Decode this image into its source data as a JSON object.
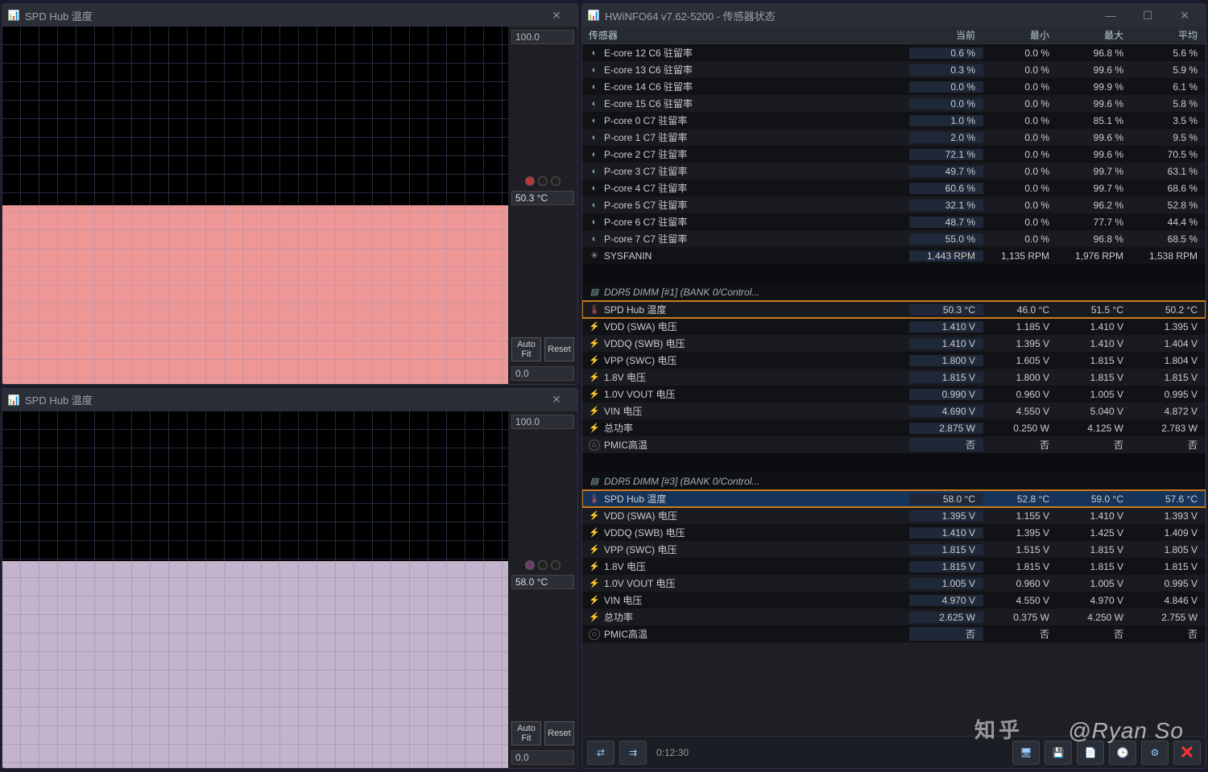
{
  "graph1": {
    "title": "SPD Hub 温度",
    "scaleTop": "100.0",
    "value": "50.3 °C",
    "autofit": "Auto Fit",
    "reset": "Reset",
    "scaleBottom": "0.0"
  },
  "graph2": {
    "title": "SPD Hub 温度",
    "scaleTop": "100.0",
    "value": "58.0 °C",
    "autofit": "Auto Fit",
    "reset": "Reset",
    "scaleBottom": "0.0"
  },
  "hw": {
    "title": "HWiNFO64 v7.62-5200 - 传感器状态",
    "cols": {
      "name": "传感器",
      "cur": "当前",
      "min": "最小",
      "max": "最大",
      "avg": "平均"
    },
    "rows": [
      {
        "t": "d",
        "icon": "chip",
        "n": "E-core 12 C6 驻留率",
        "c": "0.6 %",
        "mn": "0.0 %",
        "mx": "96.8 %",
        "a": "5.6 %"
      },
      {
        "t": "d",
        "icon": "chip",
        "n": "E-core 13 C6 驻留率",
        "c": "0.3 %",
        "mn": "0.0 %",
        "mx": "99.6 %",
        "a": "5.9 %"
      },
      {
        "t": "d",
        "icon": "chip",
        "n": "E-core 14 C6 驻留率",
        "c": "0.0 %",
        "mn": "0.0 %",
        "mx": "99.9 %",
        "a": "6.1 %"
      },
      {
        "t": "d",
        "icon": "chip",
        "n": "E-core 15 C6 驻留率",
        "c": "0.0 %",
        "mn": "0.0 %",
        "mx": "99.6 %",
        "a": "5.8 %"
      },
      {
        "t": "d",
        "icon": "chip",
        "n": "P-core 0 C7 驻留率",
        "c": "1.0 %",
        "mn": "0.0 %",
        "mx": "85.1 %",
        "a": "3.5 %"
      },
      {
        "t": "d",
        "icon": "chip",
        "n": "P-core 1 C7 驻留率",
        "c": "2.0 %",
        "mn": "0.0 %",
        "mx": "99.6 %",
        "a": "9.5 %"
      },
      {
        "t": "d",
        "icon": "chip",
        "n": "P-core 2 C7 驻留率",
        "c": "72.1 %",
        "mn": "0.0 %",
        "mx": "99.6 %",
        "a": "70.5 %"
      },
      {
        "t": "d",
        "icon": "chip",
        "n": "P-core 3 C7 驻留率",
        "c": "49.7 %",
        "mn": "0.0 %",
        "mx": "99.7 %",
        "a": "63.1 %"
      },
      {
        "t": "d",
        "icon": "chip",
        "n": "P-core 4 C7 驻留率",
        "c": "60.6 %",
        "mn": "0.0 %",
        "mx": "99.7 %",
        "a": "68.6 %"
      },
      {
        "t": "d",
        "icon": "chip",
        "n": "P-core 5 C7 驻留率",
        "c": "32.1 %",
        "mn": "0.0 %",
        "mx": "96.2 %",
        "a": "52.8 %"
      },
      {
        "t": "d",
        "icon": "chip",
        "n": "P-core 6 C7 驻留率",
        "c": "48.7 %",
        "mn": "0.0 %",
        "mx": "77.7 %",
        "a": "44.4 %"
      },
      {
        "t": "d",
        "icon": "chip",
        "n": "P-core 7 C7 驻留率",
        "c": "55.0 %",
        "mn": "0.0 %",
        "mx": "96.8 %",
        "a": "68.5 %"
      },
      {
        "t": "d",
        "icon": "fan",
        "n": "SYSFANIN",
        "c": "1,443 RPM",
        "mn": "1,135 RPM",
        "mx": "1,976 RPM",
        "a": "1,538 RPM"
      },
      {
        "t": "b"
      },
      {
        "t": "s",
        "icon": "ram",
        "n": "DDR5 DIMM [#1] (BANK 0/Control..."
      },
      {
        "t": "d",
        "icon": "therm",
        "n": "SPD Hub 温度",
        "c": "50.3 °C",
        "mn": "46.0 °C",
        "mx": "51.5 °C",
        "a": "50.2 °C",
        "box": true
      },
      {
        "t": "d",
        "icon": "bolt",
        "n": "VDD (SWA) 电压",
        "c": "1.410 V",
        "mn": "1.185 V",
        "mx": "1.410 V",
        "a": "1.395 V"
      },
      {
        "t": "d",
        "icon": "bolt",
        "n": "VDDQ (SWB) 电压",
        "c": "1.410 V",
        "mn": "1.395 V",
        "mx": "1.410 V",
        "a": "1.404 V"
      },
      {
        "t": "d",
        "icon": "bolt",
        "n": "VPP (SWC) 电压",
        "c": "1.800 V",
        "mn": "1.605 V",
        "mx": "1.815 V",
        "a": "1.804 V"
      },
      {
        "t": "d",
        "icon": "bolt",
        "n": "1.8V 电压",
        "c": "1.815 V",
        "mn": "1.800 V",
        "mx": "1.815 V",
        "a": "1.815 V"
      },
      {
        "t": "d",
        "icon": "bolt",
        "n": "1.0V VOUT 电压",
        "c": "0.990 V",
        "mn": "0.960 V",
        "mx": "1.005 V",
        "a": "0.995 V"
      },
      {
        "t": "d",
        "icon": "bolt",
        "n": "VIN 电压",
        "c": "4.690 V",
        "mn": "4.550 V",
        "mx": "5.040 V",
        "a": "4.872 V"
      },
      {
        "t": "d",
        "icon": "bolt",
        "n": "总功率",
        "c": "2.875 W",
        "mn": "0.250 W",
        "mx": "4.125 W",
        "a": "2.783 W"
      },
      {
        "t": "d",
        "icon": "dot",
        "n": "PMIC高温",
        "c": "否",
        "mn": "否",
        "mx": "否",
        "a": "否"
      },
      {
        "t": "b"
      },
      {
        "t": "s",
        "icon": "ram",
        "n": "DDR5 DIMM [#3] (BANK 0/Control..."
      },
      {
        "t": "d",
        "icon": "therm",
        "n": "SPD Hub 温度",
        "c": "58.0 °C",
        "mn": "52.8 °C",
        "mx": "59.0 °C",
        "a": "57.6 °C",
        "box": true,
        "hl": true
      },
      {
        "t": "d",
        "icon": "bolt",
        "n": "VDD (SWA) 电压",
        "c": "1.395 V",
        "mn": "1.155 V",
        "mx": "1.410 V",
        "a": "1.393 V"
      },
      {
        "t": "d",
        "icon": "bolt",
        "n": "VDDQ (SWB) 电压",
        "c": "1.410 V",
        "mn": "1.395 V",
        "mx": "1.425 V",
        "a": "1.409 V"
      },
      {
        "t": "d",
        "icon": "bolt",
        "n": "VPP (SWC) 电压",
        "c": "1.815 V",
        "mn": "1.515 V",
        "mx": "1.815 V",
        "a": "1.805 V"
      },
      {
        "t": "d",
        "icon": "bolt",
        "n": "1.8V 电压",
        "c": "1.815 V",
        "mn": "1.815 V",
        "mx": "1.815 V",
        "a": "1.815 V"
      },
      {
        "t": "d",
        "icon": "bolt",
        "n": "1.0V VOUT 电压",
        "c": "1.005 V",
        "mn": "0.960 V",
        "mx": "1.005 V",
        "a": "0.995 V"
      },
      {
        "t": "d",
        "icon": "bolt",
        "n": "VIN 电压",
        "c": "4.970 V",
        "mn": "4.550 V",
        "mx": "4.970 V",
        "a": "4.846 V"
      },
      {
        "t": "d",
        "icon": "bolt",
        "n": "总功率",
        "c": "2.625 W",
        "mn": "0.375 W",
        "mx": "4.250 W",
        "a": "2.755 W"
      },
      {
        "t": "d",
        "icon": "dot",
        "n": "PMIC高温",
        "c": "否",
        "mn": "否",
        "mx": "否",
        "a": "否"
      }
    ],
    "timer": "0:12:30"
  },
  "watermark": "知乎 @Ryan So"
}
